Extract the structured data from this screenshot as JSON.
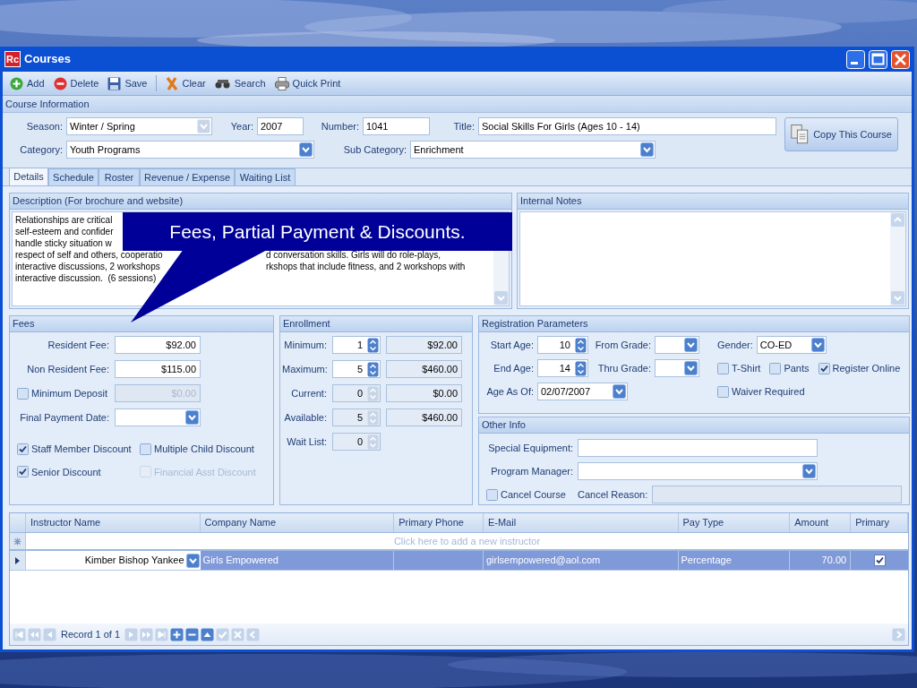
{
  "window": {
    "logo": "Rc",
    "title": "Courses"
  },
  "toolbar": [
    {
      "kind": "add",
      "label": "Add"
    },
    {
      "kind": "delete",
      "label": "Delete"
    },
    {
      "kind": "save",
      "label": "Save"
    },
    {
      "kind": "clear",
      "label": "Clear"
    },
    {
      "kind": "search",
      "label": "Search"
    },
    {
      "kind": "print",
      "label": "Quick Print"
    }
  ],
  "course_info": {
    "header": "Course Information",
    "season": {
      "label": "Season:",
      "value": "Winter / Spring",
      "disabled": true
    },
    "year": {
      "label": "Year:",
      "value": "2007"
    },
    "number": {
      "label": "Number:",
      "value": "1041"
    },
    "title": {
      "label": "Title:",
      "value": "Social Skills For Girls (Ages 10 - 14)"
    },
    "category": {
      "label": "Category:",
      "value": "Youth Programs"
    },
    "sub_category": {
      "label": "Sub Category:",
      "value": "Enrichment"
    },
    "copy_button": "Copy This Course"
  },
  "tabs": [
    {
      "label": "Details",
      "selected": true
    },
    {
      "label": "Schedule",
      "selected": false
    },
    {
      "label": "Roster",
      "selected": false
    },
    {
      "label": "Revenue / Expense",
      "selected": false
    },
    {
      "label": "Waiting List",
      "selected": false
    }
  ],
  "description": {
    "header": "Description (For brochure and website)",
    "lines": [
      {
        "left": "Relationships are critical"
      },
      {
        "left": "self-esteem and confider"
      },
      {
        "left": "handle sticky situation w"
      },
      {
        "left": "respect of self and others, cooperatio",
        "right": "d conversation skills. Girls will do role-plays,"
      },
      {
        "left": "interactive discussions, 2 workshops",
        "right": "rkshops that include fitness, and 2 workshops with"
      },
      {
        "left": "interactive discussion.  (6 sessions)"
      }
    ]
  },
  "internal_notes": {
    "header": "Internal Notes"
  },
  "callout": "Fees, Partial Payment & Discounts.",
  "fees": {
    "header": "Fees",
    "resident_fee": {
      "label": "Resident Fee:",
      "value": "$92.00"
    },
    "non_resident_fee": {
      "label": "Non Resident Fee:",
      "value": "$115.00"
    },
    "minimum_deposit": {
      "label": "Minimum Deposit",
      "checked": false,
      "value": "$0.00"
    },
    "final_payment_date": {
      "label": "Final Payment Date:"
    },
    "discounts": [
      {
        "label": "Staff Member Discount",
        "checked": true,
        "disabled": false
      },
      {
        "label": "Multiple Child Discount",
        "checked": false,
        "disabled": false
      },
      {
        "label": "Senior Discount",
        "checked": true,
        "disabled": false
      },
      {
        "label": "Financial Asst Discount",
        "checked": false,
        "disabled": true
      }
    ]
  },
  "enrollment": {
    "header": "Enrollment",
    "rows": [
      {
        "label": "Minimum:",
        "value": "1",
        "amount": "$92.00",
        "disabled": false
      },
      {
        "label": "Maximum:",
        "value": "5",
        "amount": "$460.00",
        "disabled": false
      },
      {
        "label": "Current:",
        "value": "0",
        "amount": "$0.00",
        "disabled": true
      },
      {
        "label": "Available:",
        "value": "5",
        "amount": "$460.00",
        "disabled": true
      },
      {
        "label": "Wait List:",
        "value": "0",
        "disabled": true
      }
    ]
  },
  "registration": {
    "header": "Registration Parameters",
    "start_age": {
      "label": "Start Age:",
      "value": "10"
    },
    "end_age": {
      "label": "End Age:",
      "value": "14"
    },
    "from_grade": {
      "label": "From Grade:"
    },
    "thru_grade": {
      "label": "Thru Grade:"
    },
    "gender": {
      "label": "Gender:",
      "value": "CO-ED"
    },
    "age_as_of": {
      "label": "Age As Of:",
      "value": "02/07/2007"
    },
    "options": [
      {
        "label": "T-Shirt",
        "checked": false
      },
      {
        "label": "Pants",
        "checked": false
      },
      {
        "label": "Register Online",
        "checked": true
      },
      {
        "label": "Waiver Required",
        "checked": false
      }
    ]
  },
  "other_info": {
    "header": "Other Info",
    "special_equipment": {
      "label": "Special Equipment:"
    },
    "program_manager": {
      "label": "Program Manager:"
    },
    "cancel_course": {
      "label": "Cancel Course",
      "checked": false
    },
    "cancel_reason": {
      "label": "Cancel Reason:"
    }
  },
  "grid": {
    "columns": [
      "Instructor Name",
      "Company Name",
      "Primary Phone",
      "E-Mail",
      "Pay Type",
      "Amount",
      "Primary"
    ],
    "new_row_hint": "Click here to add a new instructor",
    "rows": [
      {
        "instructor": "Kimber Bishop Yankee",
        "company": "Girls Empowered",
        "email": "girlsempowered@aol.com",
        "pay_type": "Percentage",
        "amount": "70.00",
        "primary": true,
        "selected": true
      }
    ],
    "record_label": "Record 1 of 1"
  }
}
